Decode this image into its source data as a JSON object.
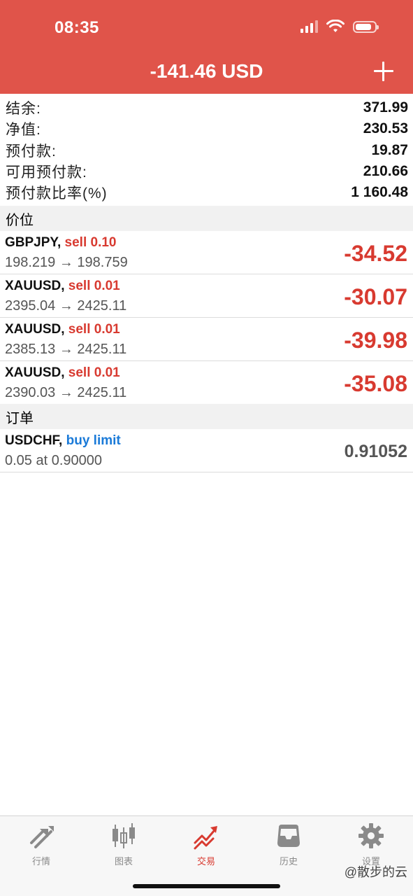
{
  "status_bar": {
    "time": "08:35"
  },
  "header": {
    "title": "-141.46 USD",
    "add_icon": "plus-icon",
    "color": "#e0544a"
  },
  "summary": [
    {
      "label": "结余:",
      "value": "371.99"
    },
    {
      "label": "净值:",
      "value": "230.53"
    },
    {
      "label": "预付款:",
      "value": "19.87"
    },
    {
      "label": "可用预付款:",
      "value": "210.66"
    },
    {
      "label": "预付款比率(%)",
      "value": "1 160.48"
    }
  ],
  "positions_section": {
    "title": "价位"
  },
  "positions": [
    {
      "symbol": "GBPJPY,",
      "action": "sell 0.10",
      "prices": "198.219 → 198.759",
      "profit": "-34.52"
    },
    {
      "symbol": "XAUUSD,",
      "action": "sell 0.01",
      "prices": "2395.04 → 2425.11",
      "profit": "-30.07"
    },
    {
      "symbol": "XAUUSD,",
      "action": "sell 0.01",
      "prices": "2385.13 → 2425.11",
      "profit": "-39.98"
    },
    {
      "symbol": "XAUUSD,",
      "action": "sell 0.01",
      "prices": "2390.03 → 2425.11",
      "profit": "-35.08"
    }
  ],
  "orders_section": {
    "title": "订单"
  },
  "orders": [
    {
      "symbol": "USDCHF,",
      "action": "buy limit",
      "details": "0.05 at 0.90000",
      "price": "0.91052"
    }
  ],
  "tabbar": {
    "tabs": [
      {
        "label": "行情",
        "icon": "quotes-arrows-icon"
      },
      {
        "label": "图表",
        "icon": "candlestick-chart-icon"
      },
      {
        "label": "交易",
        "icon": "trade-trend-icon",
        "active": true
      },
      {
        "label": "历史",
        "icon": "history-inbox-icon"
      },
      {
        "label": "设置",
        "icon": "gear-icon"
      }
    ]
  },
  "watermark": "@散步的云",
  "colors": {
    "sell": "#d83a30",
    "buy": "#1a7ad8",
    "active_tab": "#d83a30"
  }
}
